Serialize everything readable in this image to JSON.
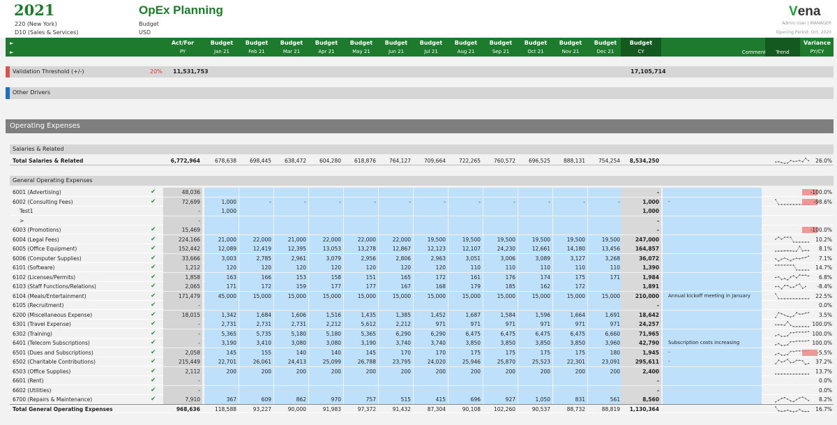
{
  "header": {
    "year": "2021",
    "entity": "220 (New York)",
    "division": "D10 (Sales & Services)",
    "title": "OpEx Planning",
    "scenario": "Budget",
    "currency": "USD",
    "logo": "vena",
    "user": "Admin User | MANAGER",
    "period": "Opening Period: Oct, 2020"
  },
  "bar": {
    "arrow": "►",
    "actfor": "Act/For",
    "py": "PY",
    "budget": "Budget",
    "months": [
      "Jan 21",
      "Feb 21",
      "Mar 21",
      "Apr 21",
      "May 21",
      "Jun 21",
      "Jul 21",
      "Aug 21",
      "Sep 21",
      "Oct 21",
      "Nov 21",
      "Dec 21"
    ],
    "cy": "CY",
    "comment": "Comment",
    "trend": "Trend",
    "variance": "Variance",
    "pycy": "PY/CY"
  },
  "validation": {
    "label": "Validation Threshold (+/-)",
    "pct": "20%",
    "py": "11,531,753",
    "cy": "17,105,714"
  },
  "other_drivers": "Other Drivers",
  "opex": "Operating Expenses",
  "salaries": {
    "section": "Salaries & Related",
    "total_label": "Total Salaries & Related",
    "py": "6,772,964",
    "months": [
      "678,638",
      "698,445",
      "638,472",
      "604,280",
      "618,876",
      "764,127",
      "709,664",
      "722,265",
      "760,572",
      "696,525",
      "888,131",
      "754,254"
    ],
    "cy": "8,534,250",
    "var": "26.0%"
  },
  "goe_section": "General Operating Expenses",
  "rows": [
    {
      "label": "6001 (Advertising)",
      "py": "48,036",
      "m": [
        "",
        "",
        "",
        "",
        "",
        "",
        "",
        "",
        "",
        "",
        "",
        ""
      ],
      "cy": "-",
      "comment": "",
      "var": "-100.0%",
      "red": true
    },
    {
      "label": "6002 (Consulting Fees)",
      "py": "72,699",
      "m": [
        "1,000",
        "-",
        "-",
        "-",
        "-",
        "-",
        "-",
        "-",
        "-",
        "-",
        "-",
        "-"
      ],
      "cy": "1,000",
      "comment": "-",
      "var": "-98.6%",
      "red": true
    },
    {
      "label": "Test1",
      "py": "-",
      "m": [
        "1,000",
        "",
        "",
        "",
        "",
        "",
        "",
        "",
        "",
        "",
        "",
        ""
      ],
      "cy": "1,000",
      "comment": "",
      "var": "",
      "sub": true
    },
    {
      "label": ">",
      "py": "-",
      "m": [
        "",
        "",
        "",
        "",
        "",
        "",
        "",
        "",
        "",
        "",
        "",
        ""
      ],
      "cy": "-",
      "comment": "",
      "var": "",
      "sub": true
    },
    {
      "label": "6003 (Promotions)",
      "py": "15,469",
      "m": [
        "",
        "",
        "",
        "",
        "",
        "",
        "",
        "",
        "",
        "",
        "",
        ""
      ],
      "cy": "-",
      "comment": "",
      "var": "-100.0%",
      "red": true
    },
    {
      "label": "6004 (Legal Fees)",
      "py": "224,166",
      "m": [
        "21,000",
        "22,000",
        "21,000",
        "22,000",
        "22,000",
        "22,000",
        "19,500",
        "19,500",
        "19,500",
        "19,500",
        "19,500",
        "19,500"
      ],
      "cy": "247,000",
      "comment": "",
      "var": "10.2%"
    },
    {
      "label": "6005 (Office Equipment)",
      "py": "152,442",
      "m": [
        "12,089",
        "12,419",
        "12,395",
        "13,053",
        "13,278",
        "12,867",
        "12,123",
        "12,107",
        "24,230",
        "12,661",
        "14,180",
        "13,456"
      ],
      "cy": "164,857",
      "comment": "",
      "var": "8.1%"
    },
    {
      "label": "6006 (Computer Supplies)",
      "py": "33,666",
      "m": [
        "3,003",
        "2,785",
        "2,961",
        "3,079",
        "2,956",
        "2,806",
        "2,963",
        "3,051",
        "3,006",
        "3,089",
        "3,127",
        "3,268"
      ],
      "cy": "36,072",
      "comment": "",
      "var": "7.1%"
    },
    {
      "label": "6101 (Software)",
      "py": "1,212",
      "m": [
        "120",
        "120",
        "120",
        "120",
        "120",
        "120",
        "120",
        "110",
        "110",
        "110",
        "110",
        "110"
      ],
      "cy": "1,390",
      "comment": "",
      "var": "14.7%"
    },
    {
      "label": "6102 (Licenses/Permits)",
      "py": "1,858",
      "m": [
        "163",
        "166",
        "153",
        "158",
        "151",
        "165",
        "172",
        "161",
        "176",
        "174",
        "175",
        "171"
      ],
      "cy": "1,984",
      "comment": "",
      "var": "6.8%"
    },
    {
      "label": "6103 (Staff Functions/Relations)",
      "py": "2,065",
      "m": [
        "171",
        "172",
        "159",
        "177",
        "177",
        "167",
        "168",
        "179",
        "185",
        "162",
        "172",
        ""
      ],
      "cy": "1,891",
      "comment": "",
      "var": "-8.4%"
    },
    {
      "label": "6104 (Meals/Entertainment)",
      "py": "171,479",
      "m": [
        "45,000",
        "15,000",
        "15,000",
        "15,000",
        "15,000",
        "15,000",
        "15,000",
        "15,000",
        "15,000",
        "15,000",
        "15,000",
        "15,000"
      ],
      "cy": "210,000",
      "comment": "Annual kickoff meeting in January",
      "var": "22.5%"
    },
    {
      "label": "6105 (Recruitment)",
      "py": "-",
      "m": [
        "",
        "",
        "",
        "",
        "",
        "",
        "",
        "",
        "",
        "",
        "",
        ""
      ],
      "cy": "-",
      "comment": "",
      "var": "0.0%"
    },
    {
      "label": "6200 (Miscellaneous Expense)",
      "py": "18,015",
      "m": [
        "1,342",
        "1,684",
        "1,606",
        "1,516",
        "1,435",
        "1,385",
        "1,452",
        "1,687",
        "1,584",
        "1,596",
        "1,664",
        "1,691"
      ],
      "cy": "18,642",
      "comment": "",
      "var": "3.5%"
    },
    {
      "label": "6301 (Travel Expense)",
      "py": "-",
      "m": [
        "2,731",
        "2,731",
        "2,731",
        "2,212",
        "5,612",
        "2,212",
        "971",
        "971",
        "971",
        "971",
        "971",
        "971"
      ],
      "cy": "24,257",
      "comment": "",
      "var": "100.0%"
    },
    {
      "label": "6302 (Training)",
      "py": "-",
      "m": [
        "5,365",
        "5,735",
        "5,180",
        "5,180",
        "5,365",
        "6,290",
        "6,290",
        "6,475",
        "6,475",
        "6,475",
        "6,475",
        "6,660"
      ],
      "cy": "71,965",
      "comment": "",
      "var": "100.0%"
    },
    {
      "label": "6401 (Telecom Subscriptions)",
      "py": "-",
      "m": [
        "3,190",
        "3,410",
        "3,080",
        "3,080",
        "3,190",
        "3,740",
        "3,740",
        "3,850",
        "3,850",
        "3,850",
        "3,850",
        "3,960"
      ],
      "cy": "42,790",
      "comment": "Subscription costs increasing",
      "var": "100.0%"
    },
    {
      "label": "6501 (Dues and Subscriptions)",
      "py": "2,058",
      "m": [
        "145",
        "155",
        "140",
        "140",
        "145",
        "170",
        "170",
        "175",
        "175",
        "175",
        "175",
        "180"
      ],
      "cy": "1,945",
      "comment": "-",
      "var": "-5.5%",
      "red": true
    },
    {
      "label": "6502 (Charitable Contributions)",
      "py": "215,449",
      "m": [
        "22,701",
        "26,061",
        "24,413",
        "25,099",
        "26,788",
        "23,795",
        "24,020",
        "25,946",
        "25,870",
        "25,523",
        "22,301",
        "23,091"
      ],
      "cy": "295,611",
      "comment": "-",
      "var": "37.2%"
    },
    {
      "label": "6503 (Office Supplies)",
      "py": "2,112",
      "m": [
        "200",
        "200",
        "200",
        "200",
        "200",
        "200",
        "200",
        "200",
        "200",
        "200",
        "200",
        "200"
      ],
      "cy": "2,400",
      "comment": "",
      "var": "13.7%"
    },
    {
      "label": "6601 (Rent)",
      "py": "-",
      "m": [
        "",
        "",
        "",
        "",
        "",
        "",
        "",
        "",
        "",
        "",
        "",
        ""
      ],
      "cy": "-",
      "comment": "",
      "var": "0.0%"
    },
    {
      "label": "6602 (Utilities)",
      "py": "-",
      "m": [
        "",
        "",
        "",
        "",
        "",
        "",
        "",
        "",
        "",
        "",
        "",
        ""
      ],
      "cy": "-",
      "comment": "",
      "var": "0.0%"
    },
    {
      "label": "6700 (Repairs & Maintenance)",
      "py": "7,910",
      "m": [
        "367",
        "609",
        "862",
        "970",
        "757",
        "515",
        "415",
        "696",
        "927",
        "1,050",
        "831",
        "561"
      ],
      "cy": "8,560",
      "comment": "",
      "var": "8.2%"
    }
  ],
  "goe_total": {
    "label": "Total General Operating Expenses",
    "py": "968,636",
    "months": [
      "118,588",
      "93,227",
      "90,000",
      "91,983",
      "97,372",
      "91,432",
      "87,304",
      "90,108",
      "102,260",
      "90,537",
      "88,732",
      "88,819"
    ],
    "cy": "1,130,364",
    "var": "16.7%"
  }
}
